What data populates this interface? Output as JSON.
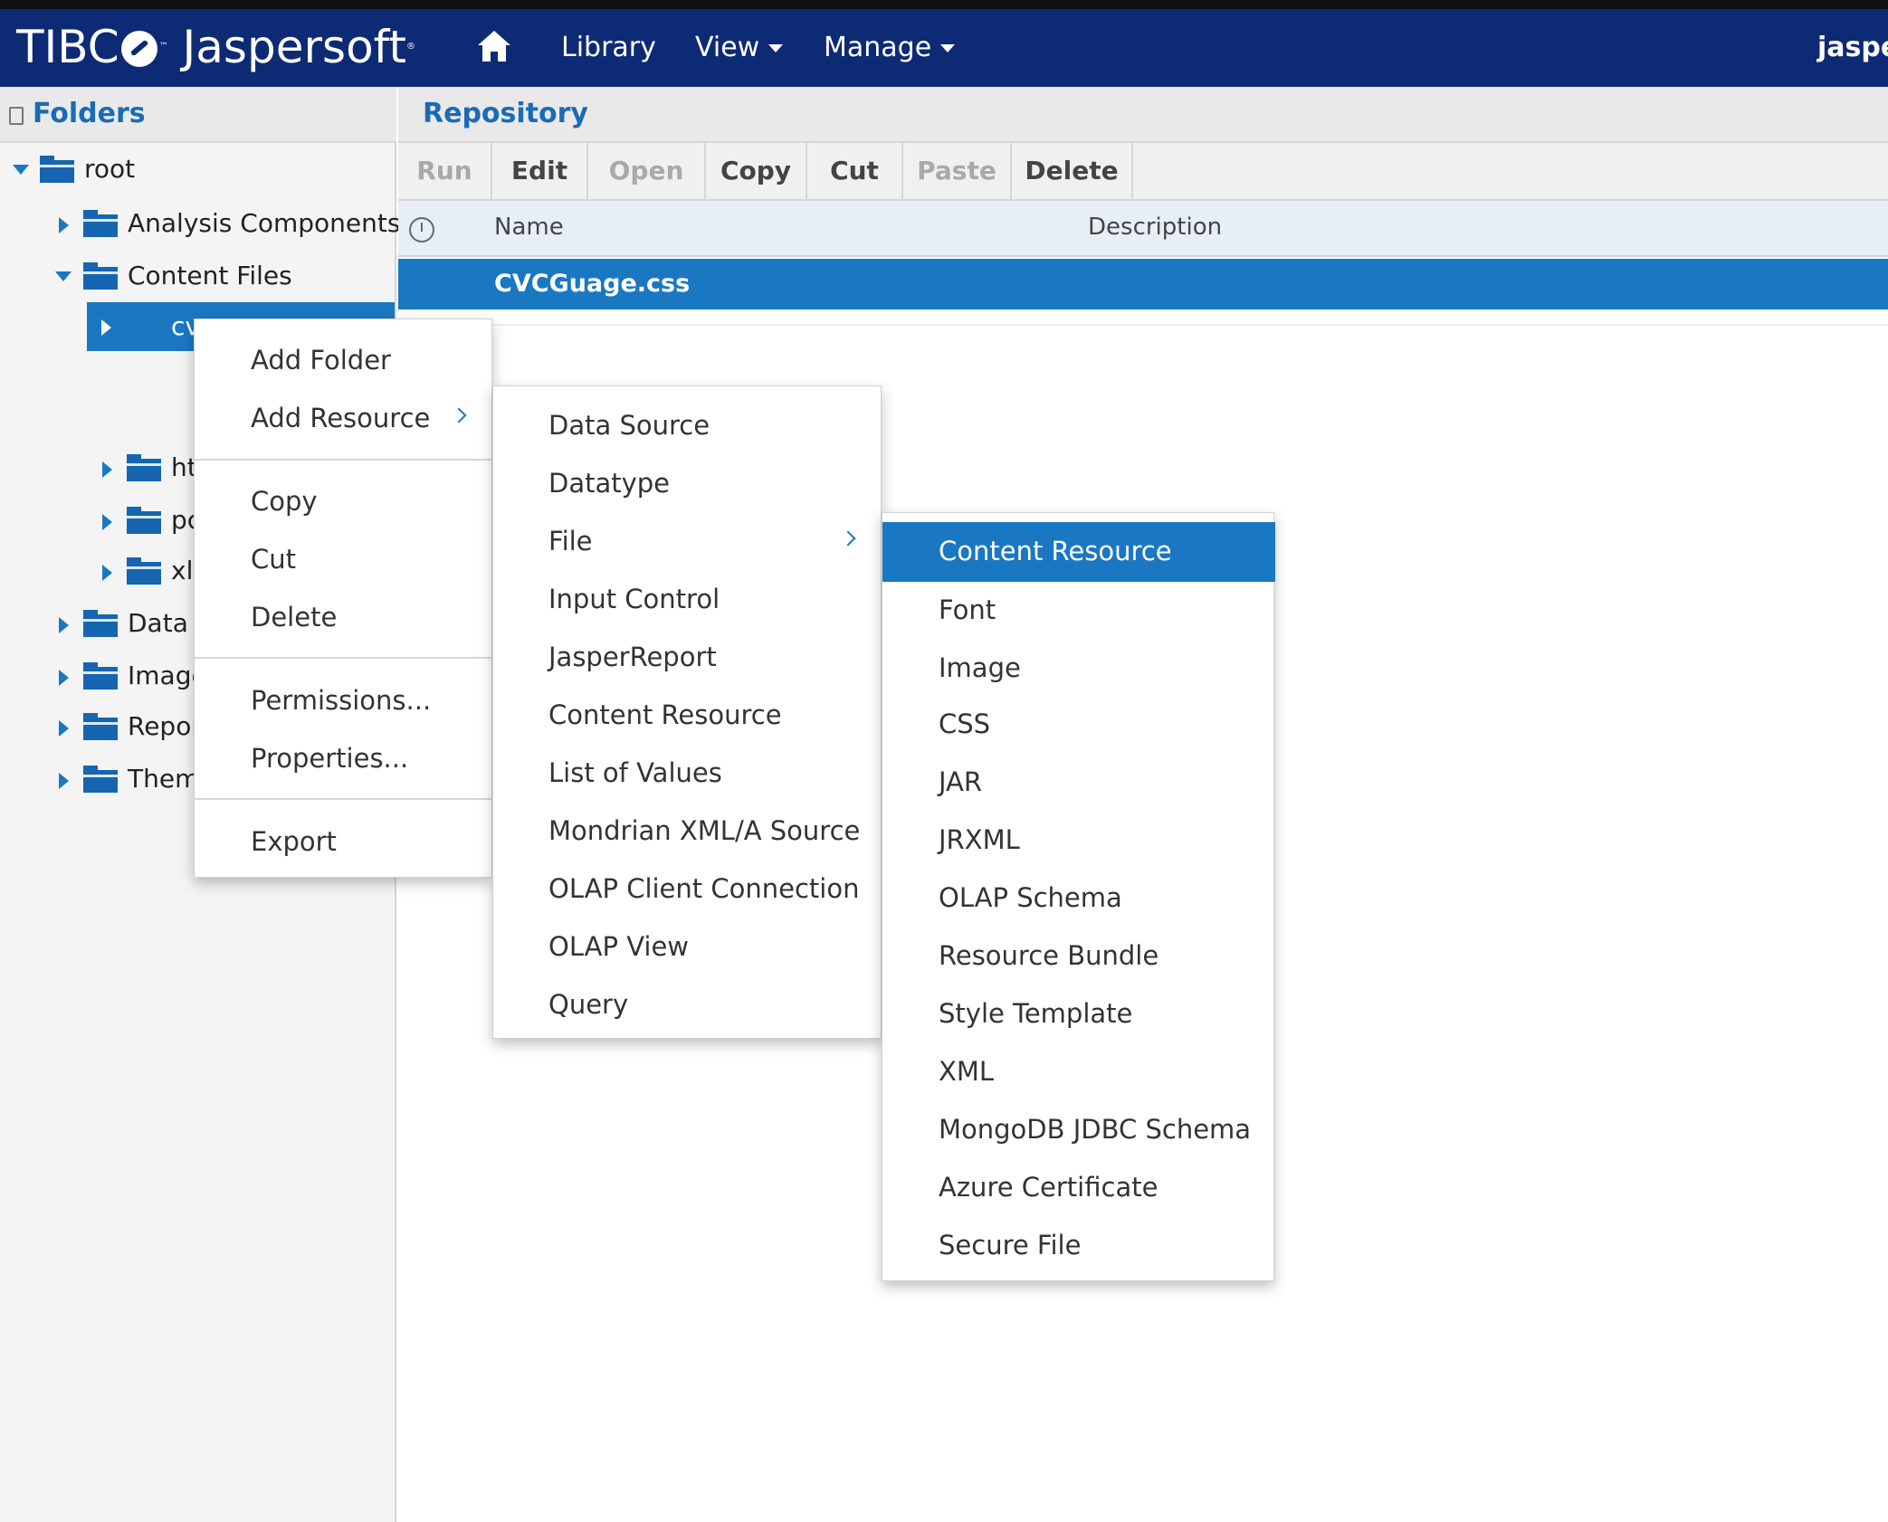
{
  "header": {
    "logo_text_a": "TIBC",
    "logo_text_b": "Jaspersoft",
    "nav": {
      "home_icon": "home-icon",
      "library": "Library",
      "view": "View",
      "manage": "Manage"
    },
    "user": "jasper"
  },
  "folders_panel": {
    "title": "Folders",
    "tree": [
      {
        "label": "root",
        "expanded": true
      },
      {
        "label": "Analysis Components",
        "expanded": false
      },
      {
        "label": "Content Files",
        "expanded": true
      },
      {
        "label": "cv",
        "expanded": false,
        "selected": true
      },
      {
        "label": "ht",
        "expanded": false
      },
      {
        "label": "pc",
        "expanded": false
      },
      {
        "label": "xls",
        "expanded": false
      },
      {
        "label": "Data S",
        "expanded": false
      },
      {
        "label": "Image",
        "expanded": false
      },
      {
        "label": "Repor",
        "expanded": false
      },
      {
        "label": "Theme",
        "expanded": false
      }
    ]
  },
  "repository": {
    "title": "Repository",
    "toolbar": [
      {
        "label": "Run",
        "enabled": false
      },
      {
        "label": "Edit",
        "enabled": true
      },
      {
        "label": "Open",
        "enabled": false
      },
      {
        "label": "Copy",
        "enabled": true
      },
      {
        "label": "Cut",
        "enabled": true
      },
      {
        "label": "Paste",
        "enabled": false
      },
      {
        "label": "Delete",
        "enabled": true
      }
    ],
    "columns": {
      "name": "Name",
      "description": "Description"
    },
    "rows": [
      {
        "name": "CVCGuage.css",
        "selected": true
      }
    ]
  },
  "context_menu": {
    "items": [
      "Add Folder",
      "Add Resource",
      "Copy",
      "Cut",
      "Delete",
      "Permissions...",
      "Properties...",
      "Export"
    ]
  },
  "add_resource_menu": {
    "items": [
      "Data Source",
      "Datatype",
      "File",
      "Input Control",
      "JasperReport",
      "Content Resource",
      "List of Values",
      "Mondrian XML/A Source",
      "OLAP Client Connection",
      "OLAP View",
      "Query"
    ]
  },
  "file_menu": {
    "highlighted": "Content Resource",
    "items": [
      "Content Resource",
      "Font",
      "Image",
      "CSS",
      "JAR",
      "JRXML",
      "OLAP Schema",
      "Resource Bundle",
      "Style Template",
      "XML",
      "MongoDB JDBC Schema",
      "Azure Certificate",
      "Secure File"
    ]
  },
  "colors": {
    "header_bg": "#0d2a74",
    "accent": "#1a78c2",
    "title_blue": "#1a6bb5"
  }
}
